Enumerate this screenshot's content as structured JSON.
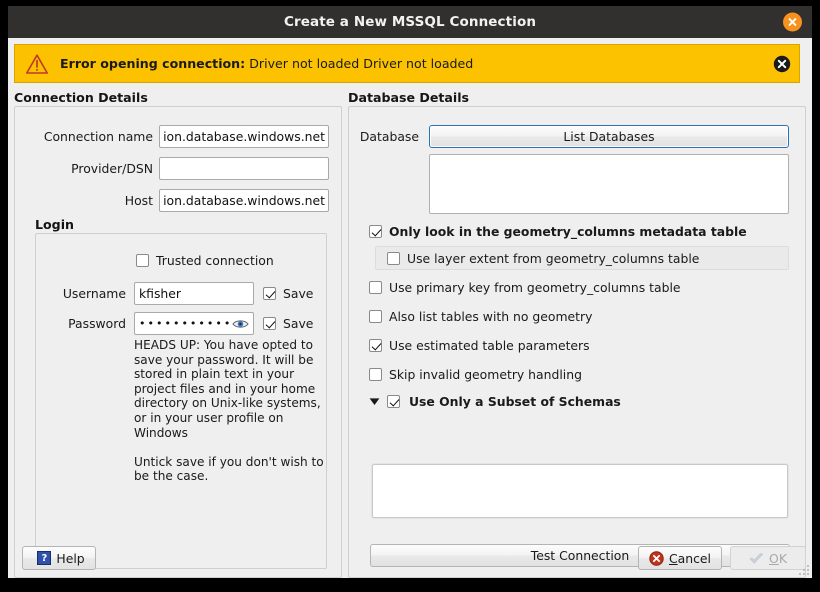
{
  "titlebar": {
    "title": "Create a New MSSQL Connection",
    "close_icon": "close-icon"
  },
  "warning": {
    "icon": "warning-triangle-icon",
    "prefix": "Error opening connection:",
    "message": "Driver not loaded Driver not loaded",
    "dismiss_icon": "dismiss-icon",
    "background_color": "#fcc200"
  },
  "connection_details": {
    "title": "Connection Details",
    "fields": [
      {
        "label": "Connection name",
        "value": "ion.database.windows.net",
        "placeholder": ""
      },
      {
        "label": "Provider/DSN",
        "value": "",
        "placeholder": ""
      },
      {
        "label": "Host",
        "value": "ion.database.windows.net",
        "placeholder": ""
      }
    ],
    "login": {
      "title": "Login",
      "trusted_connection": {
        "label": "Trusted connection",
        "checked": false
      },
      "username": {
        "label": "Username",
        "value": "kfisher",
        "save_label": "Save",
        "save_checked": true
      },
      "password": {
        "label": "Password",
        "value": "•••••••••••••",
        "save_label": "Save",
        "save_checked": true,
        "reveal_icon": "eye-icon"
      },
      "heads_up": "HEADS UP: You have opted to save your password. It will be stored in plain text in your project files and in your home directory on Unix-like systems, or in your user profile on Windows\n\nUntick save if you don't wish to be the case."
    }
  },
  "database_details": {
    "title": "Database Details",
    "database_label": "Database",
    "list_databases_label": "List Databases",
    "database_list_items": [],
    "options": [
      {
        "label": "Only look in the geometry_columns metadata table",
        "checked": true,
        "bold": true
      },
      {
        "label": "Use layer extent from geometry_columns table",
        "checked": false,
        "bold": false,
        "nested": true
      },
      {
        "label": "Use primary key from geometry_columns table",
        "checked": false,
        "bold": false
      },
      {
        "label": "Also list tables with no geometry",
        "checked": false,
        "bold": false
      },
      {
        "label": "Use estimated table parameters",
        "checked": true,
        "bold": false
      },
      {
        "label": "Skip invalid geometry handling",
        "checked": false,
        "bold": false
      }
    ],
    "schemas": {
      "label": "Use Only a Subset of Schemas",
      "checked": true,
      "expanded": true,
      "expander_icon": "chevron-down-icon",
      "items": []
    },
    "test_connection_label": "Test Connection"
  },
  "buttons": {
    "help": {
      "label": "Help",
      "icon": "help-icon"
    },
    "cancel": {
      "label": "Cancel",
      "accel": "C",
      "icon": "cancel-icon"
    },
    "ok": {
      "label": "OK",
      "accel": "O",
      "icon": "ok-icon",
      "disabled": true
    }
  }
}
